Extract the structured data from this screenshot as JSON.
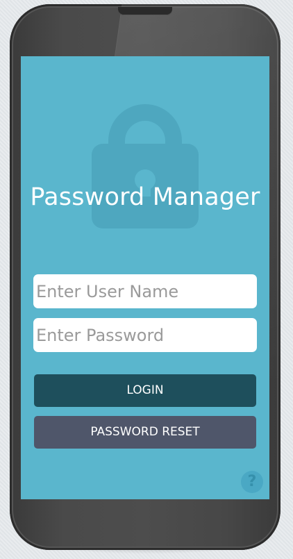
{
  "app": {
    "title": "Password Manager"
  },
  "login_form": {
    "username": {
      "value": "",
      "placeholder": "Enter User Name"
    },
    "password": {
      "value": "",
      "placeholder": "Enter Password"
    },
    "login_label": "LOGIN",
    "reset_label": "PASSWORD RESET"
  },
  "help": {
    "label": "?"
  },
  "icons": {
    "background": "lock-icon",
    "help": "help-icon"
  },
  "colors": {
    "screen": "#5ab6cd",
    "login_button": "#1e4f5c",
    "reset_button": "#4f566a",
    "lock_watermark": "#4ea7bf"
  }
}
